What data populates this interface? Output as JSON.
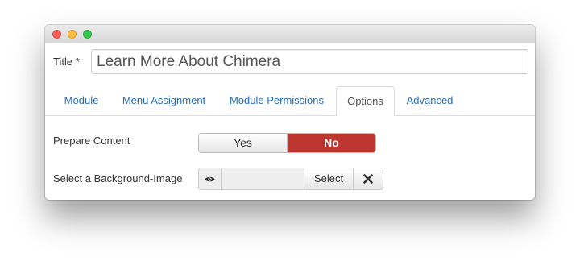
{
  "window": {
    "buttons": [
      "close",
      "minimize",
      "maximize"
    ]
  },
  "form": {
    "title_label": "Title *",
    "title_value": "Learn More About Chimera"
  },
  "tabs": [
    {
      "label": "Module",
      "active": false
    },
    {
      "label": "Menu Assignment",
      "active": false
    },
    {
      "label": "Module Permissions",
      "active": false
    },
    {
      "label": "Options",
      "active": true
    },
    {
      "label": "Advanced",
      "active": false
    }
  ],
  "options": {
    "prepare_content": {
      "label": "Prepare Content",
      "yes": "Yes",
      "no": "No",
      "selected": "No"
    },
    "background_image": {
      "label": "Select a Background-Image",
      "value": "",
      "select_label": "Select",
      "preview_icon": "eye-icon",
      "clear_icon": "x-icon"
    }
  },
  "colors": {
    "link": "#2a6db5",
    "danger": "#bd362f"
  }
}
